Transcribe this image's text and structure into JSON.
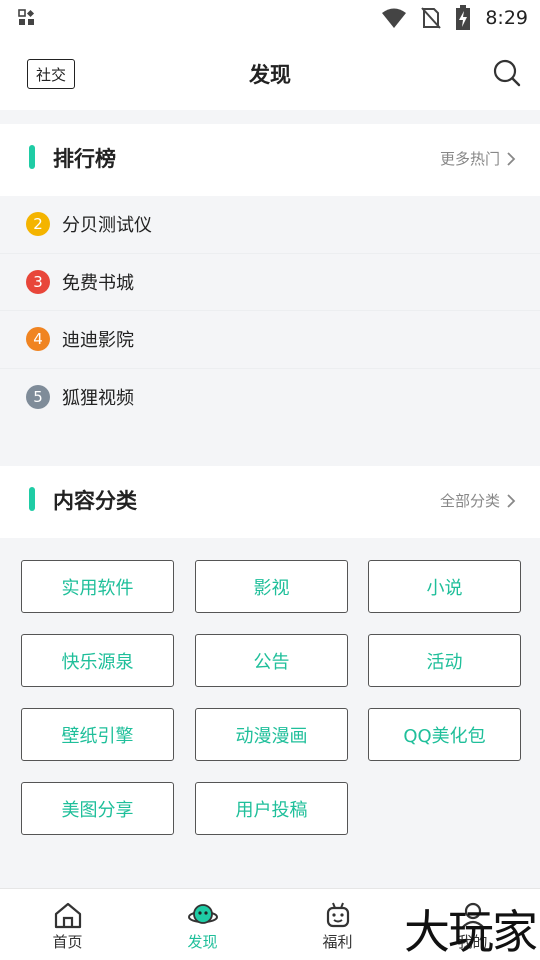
{
  "status_bar": {
    "time": "8:29",
    "icons": [
      "apps-grid-icon",
      "wifi-icon",
      "no-sim-icon",
      "battery-charging-icon"
    ]
  },
  "header": {
    "social_label": "社交",
    "title": "发现",
    "search_icon": "search-icon"
  },
  "ranking": {
    "title": "排行榜",
    "more_label": "更多热门",
    "items": [
      {
        "rank": "2",
        "name": "分贝测试仪",
        "color": "#f4b400"
      },
      {
        "rank": "3",
        "name": "免费书城",
        "color": "#e8463a"
      },
      {
        "rank": "4",
        "name": "迪迪影院",
        "color": "#f08421"
      },
      {
        "rank": "5",
        "name": "狐狸视频",
        "color": "#7f8c99"
      }
    ]
  },
  "categories": {
    "title": "内容分类",
    "more_label": "全部分类",
    "items": [
      "实用软件",
      "影视",
      "小说",
      "快乐源泉",
      "公告",
      "活动",
      "壁纸引擎",
      "动漫漫画",
      "QQ美化包",
      "美图分享",
      "用户投稿"
    ]
  },
  "bottom_nav": {
    "items": [
      {
        "label": "首页",
        "icon": "home-icon"
      },
      {
        "label": "发现",
        "icon": "planet-icon",
        "active": true
      },
      {
        "label": "福利",
        "icon": "gift-robot-icon"
      },
      {
        "label": "我的",
        "icon": "user-icon"
      }
    ]
  },
  "watermark": "大玩家",
  "colors": {
    "accent": "#1fcca5",
    "text": "#222222",
    "muted": "#888888",
    "background": "#f4f5f7"
  }
}
